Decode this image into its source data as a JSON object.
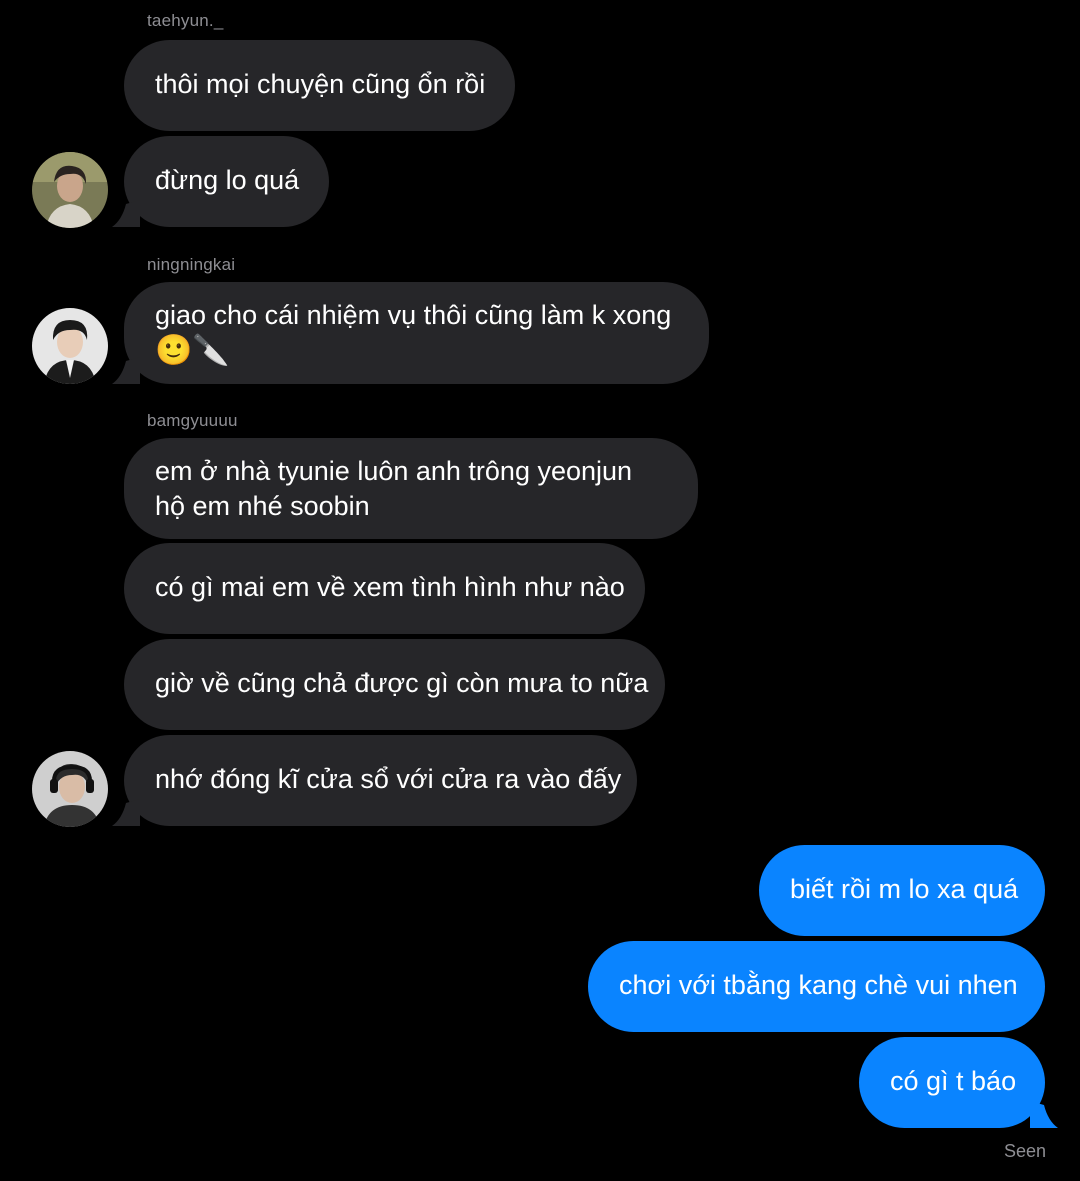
{
  "chat": {
    "messages": [
      {
        "sender": "taehyun._",
        "text": "thôi mọi chuyện cũng ổn rồi"
      },
      {
        "text": "đừng lo quá"
      },
      {
        "sender": "ningningkai",
        "text": "giao cho cái nhiệm vụ thôi cũng làm k xong",
        "emoji": [
          "🙂",
          "🔪"
        ]
      },
      {
        "sender": "bamgyuuuu",
        "text": "em ở nhà tyunie luôn anh trông yeonjun hộ em nhé soobin"
      },
      {
        "text": "có gì mai em về xem tình hình như nào"
      },
      {
        "text": "giờ về cũng chả được gì còn mưa to nữa"
      },
      {
        "text": "nhớ đóng kĩ cửa sổ với cửa ra vào đấy"
      },
      {
        "text": "biết rồi m lo xa quá"
      },
      {
        "text": "chơi với tbằng kang chè vui nhen"
      },
      {
        "text": "có gì t báo"
      }
    ],
    "seen_label": "Seen"
  },
  "colors": {
    "background": "#000000",
    "incoming_bubble": "#262629",
    "outgoing_bubble": "#0a84ff",
    "sender_name": "#8e8e93"
  }
}
